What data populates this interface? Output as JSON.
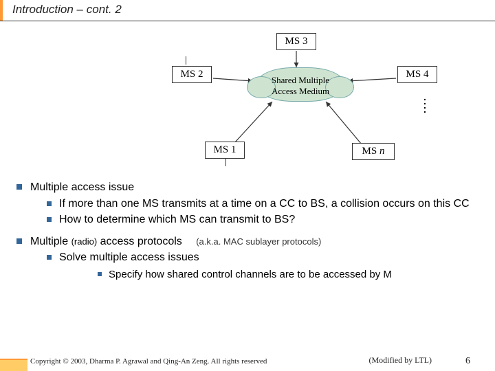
{
  "title": "Introduction – cont. 2",
  "diagram": {
    "ms1": "MS 1",
    "ms2": "MS 2",
    "ms3": "MS 3",
    "ms4": "MS 4",
    "msn_prefix": "MS ",
    "msn_suffix": "n",
    "cloud_line1": "Shared Multiple",
    "cloud_line2": "Access Medium"
  },
  "bullets": {
    "b1": "Multiple access issue",
    "b1a": "If more than one MS transmits at a time on a CC to BS, a collision occurs on this CC",
    "b1b": "How to determine which MS can transmit to BS?",
    "b2_part1": "Multiple ",
    "b2_radio": "(radio)",
    "b2_part2": " access protocols",
    "b2_aka": "(a.k.a. MAC sublayer protocols)",
    "b2a": "Solve multiple access issues",
    "b2a1": "Specify how shared control channels are to be accessed by M"
  },
  "footer": {
    "copyright": "Copyright © 2003, Dharma P. Agrawal and Qing-An Zeng. All rights reserved",
    "modified": "(Modified by LTL)",
    "page": "6"
  }
}
